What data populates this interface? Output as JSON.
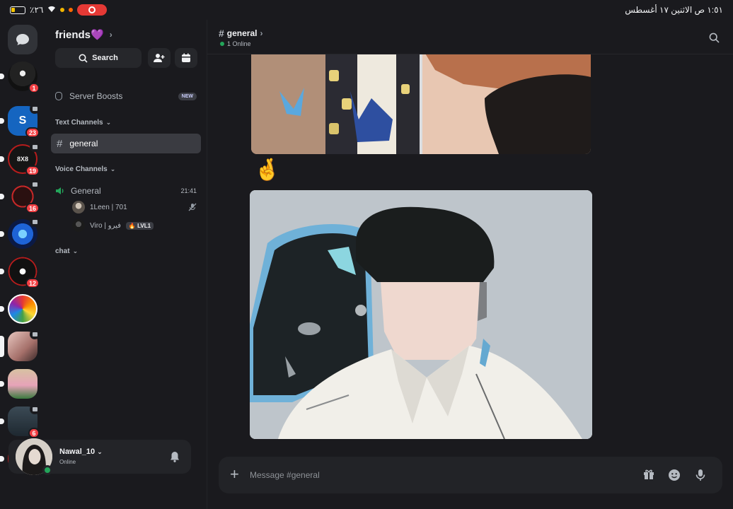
{
  "status_bar": {
    "time_date": "١:٥١ ص   الاثنين ١٧ أغسطس",
    "battery": "٪٢٦"
  },
  "server": {
    "name": "friends💜"
  },
  "sidebar": {
    "search_label": "Search",
    "boosts_label": "Server Boosts",
    "boosts_tag": "NEW",
    "text_category": "Text Channels",
    "active_channel": "general",
    "voice_category": "Voice Channels",
    "voice_channel": {
      "name": "General",
      "time": "21:41"
    },
    "voice_users": [
      {
        "name": "1Leen | 701"
      },
      {
        "name": "Viro | فيرو",
        "badge": "LVL1"
      }
    ],
    "chat_category": "chat"
  },
  "rail": {
    "badges": [
      "1",
      "23",
      "19",
      "16",
      "12",
      "6"
    ]
  },
  "user": {
    "name": "Nawal_10",
    "status": "Online"
  },
  "channel_header": {
    "name": "general",
    "online": "1 Online"
  },
  "composer": {
    "placeholder": "Message #general"
  },
  "colors": {
    "background": "#1a1a1e",
    "accent_online": "#23a55a",
    "badge_red": "#f23f43",
    "record_red": "#e53935"
  },
  "icons": [
    "chat-bubble-icon",
    "search-icon",
    "add-member-icon",
    "calendar-icon",
    "boost-gem-icon",
    "speaker-icon",
    "muted-mic-icon",
    "bell-icon",
    "gift-icon",
    "emoji-icon",
    "mic-icon",
    "plus-icon"
  ]
}
